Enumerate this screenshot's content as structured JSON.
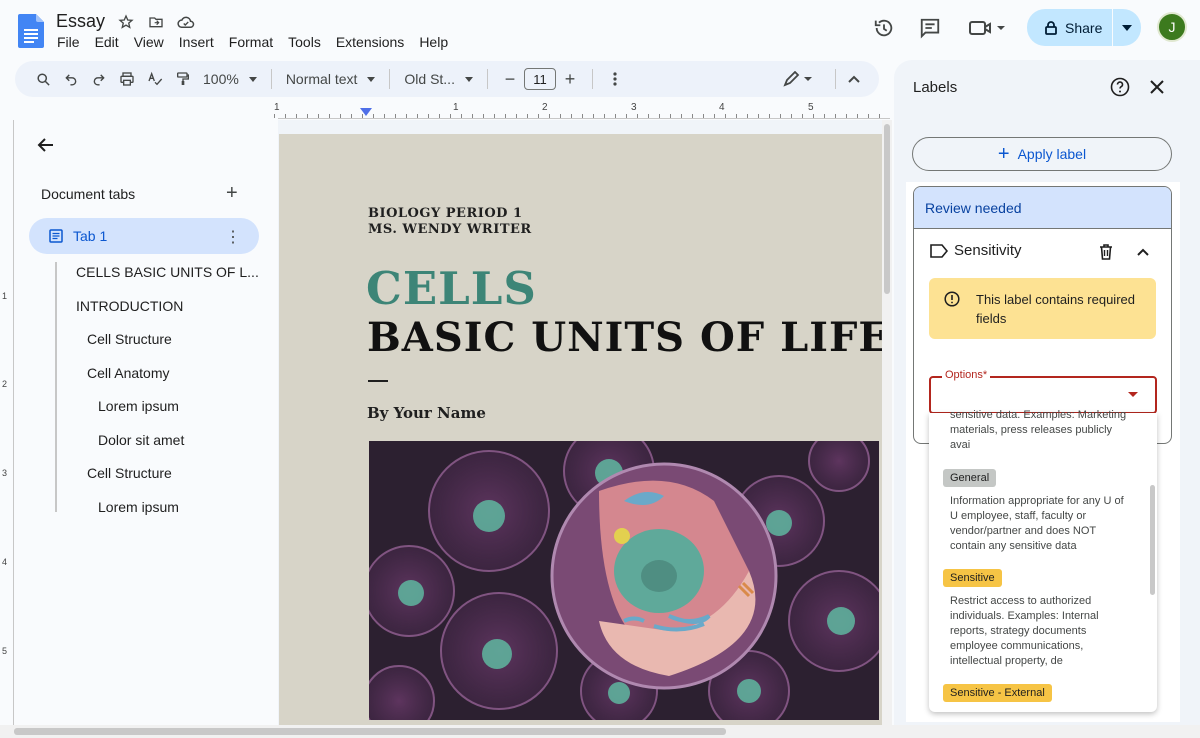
{
  "app": {
    "doc_title": "Essay",
    "menu": [
      "File",
      "Edit",
      "View",
      "Insert",
      "Format",
      "Tools",
      "Extensions",
      "Help"
    ],
    "share_label": "Share",
    "avatar_initial": "J"
  },
  "toolbar": {
    "zoom": "100%",
    "style": "Normal text",
    "font": "Old St...",
    "font_size": "11",
    "minus": "−",
    "plus": "+"
  },
  "ruler": [
    "1",
    "1",
    "2",
    "3",
    "4",
    "5"
  ],
  "vruler": [
    "1",
    "2",
    "3",
    "4",
    "5"
  ],
  "sidebar": {
    "title": "Document tabs",
    "add": "+",
    "tab_label": "Tab 1",
    "outline": [
      {
        "label": "CELLS BASIC UNITS OF L...",
        "level": 1
      },
      {
        "label": "INTRODUCTION",
        "level": 1
      },
      {
        "label": "Cell Structure",
        "level": 2
      },
      {
        "label": "Cell Anatomy",
        "level": 2
      },
      {
        "label": "Lorem ipsum",
        "level": 3
      },
      {
        "label": "Dolor sit amet",
        "level": 3
      },
      {
        "label": "Cell Structure",
        "level": 2
      },
      {
        "label": "Lorem ipsum",
        "level": 3
      }
    ]
  },
  "document": {
    "class_line": "BIOLOGY PERIOD 1",
    "teacher_line": "MS. WENDY WRITER",
    "title_accent": "CELLS",
    "title_main": "BASIC UNITS OF LIFE",
    "byline": "By Your Name"
  },
  "labels_panel": {
    "title": "Labels",
    "apply_label": "Apply label",
    "review_needed": "Review needed",
    "label_name": "Sensitivity",
    "warning": "This label contains required fields",
    "options_label": "Options*",
    "options": [
      {
        "name": "",
        "description": "sensitive data. Examples: Marketing materials, press releases publicly avai"
      },
      {
        "name": "General",
        "description": "Information appropriate for any U of U employee, staff, faculty or vendor/partner and does NOT contain any sensitive data"
      },
      {
        "name": "Sensitive",
        "description": "Restrict access to authorized individuals. Examples: Internal reports, strategy documents employee communications, intellectual property, de"
      },
      {
        "name": "Sensitive - External",
        "description": ""
      }
    ]
  },
  "colors": {
    "share_bg": "#c2e7ff",
    "tab_active_bg": "#d3e3fd",
    "accent_blue": "#0b57d0",
    "title_accent": "#3d8577",
    "error_red": "#b3261e",
    "warning_bg": "#fde293",
    "chip_general": "#c4c7c5",
    "chip_sensitive": "#f6c445"
  }
}
